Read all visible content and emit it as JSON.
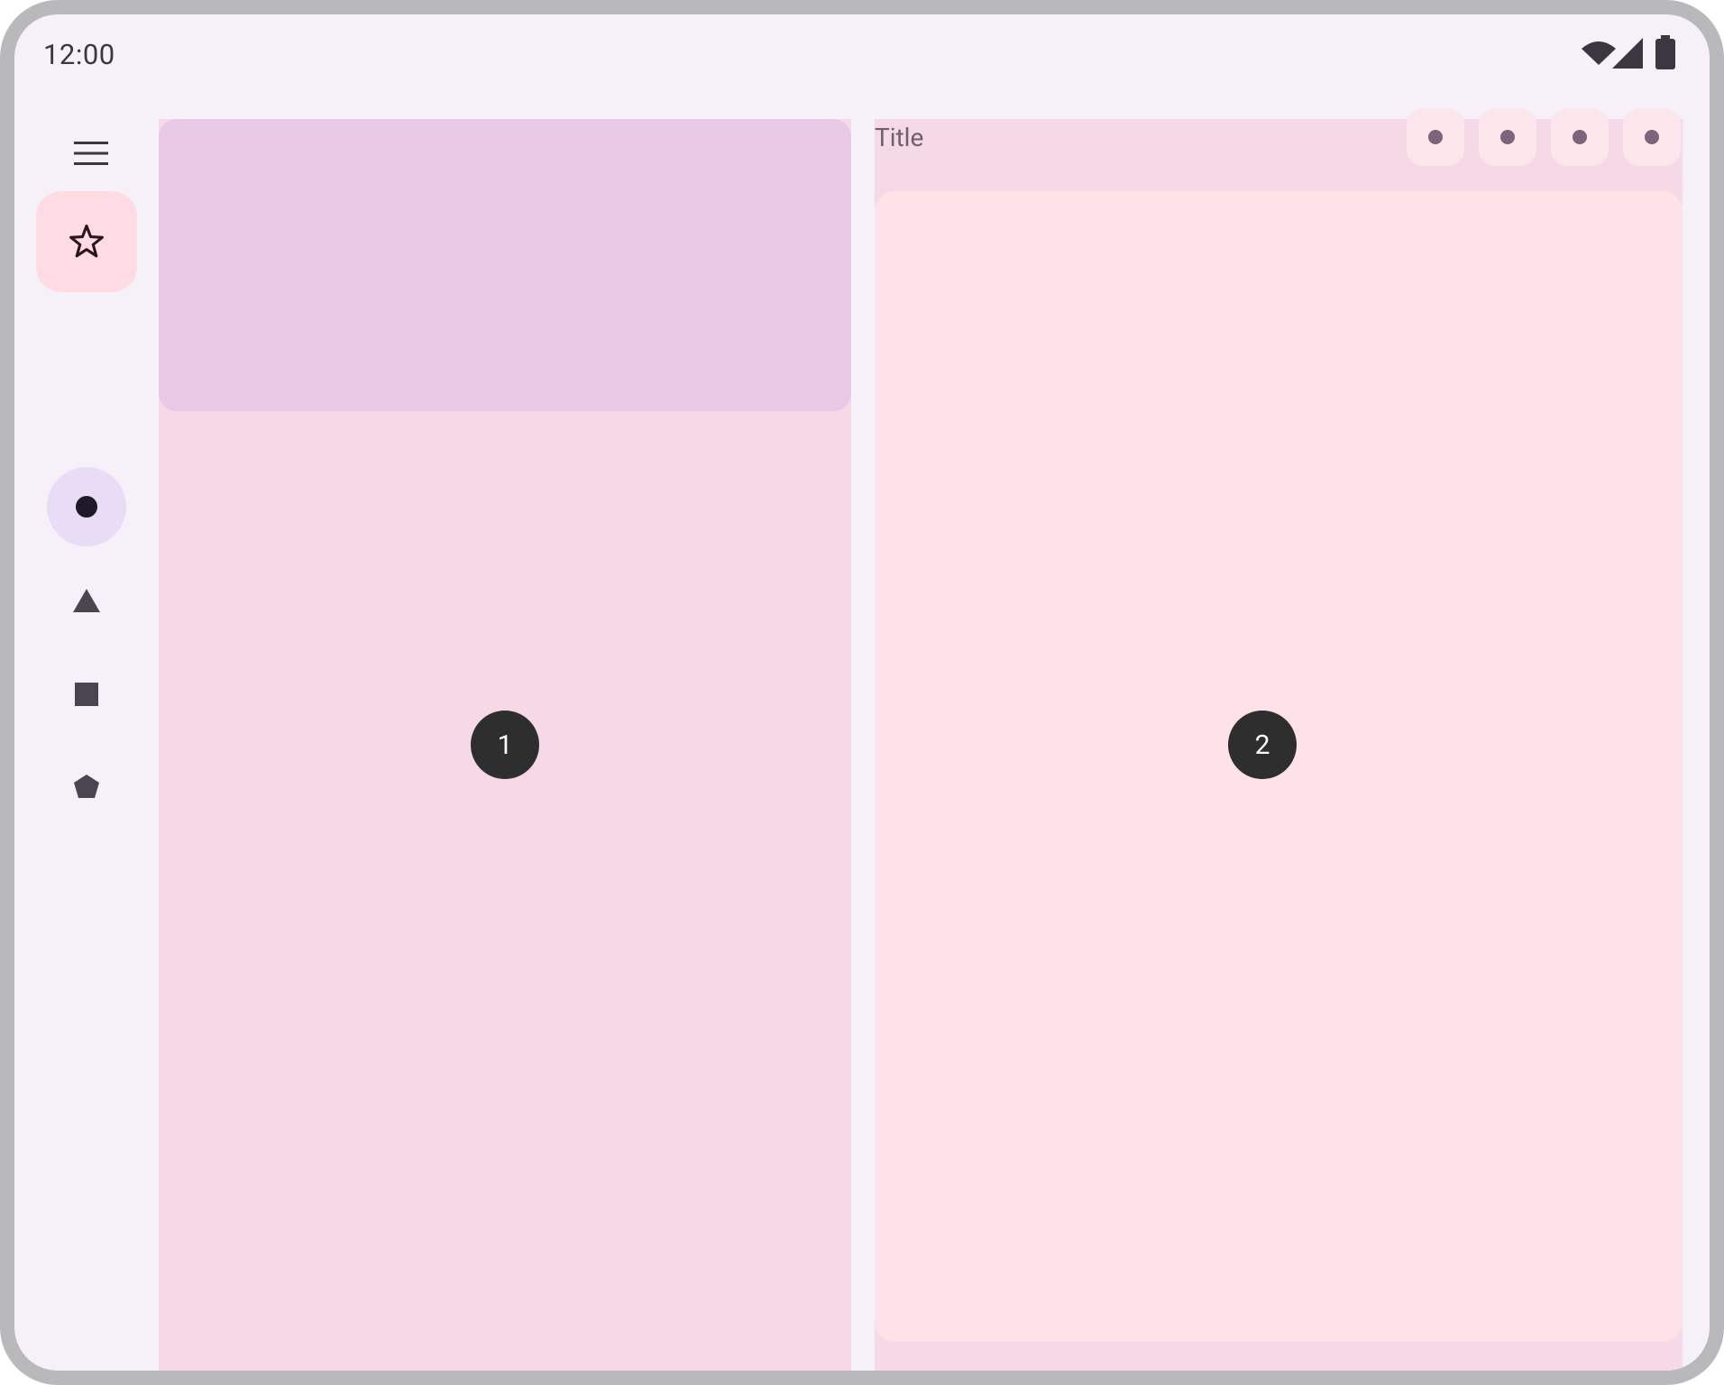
{
  "status_bar": {
    "time": "12:00",
    "icons": [
      "wifi-icon",
      "cellular-signal-icon",
      "battery-icon"
    ]
  },
  "rail": {
    "menu_icon": "hamburger-menu-icon",
    "fab_icon": "star-outline-icon",
    "items": [
      {
        "icon": "circle-icon",
        "selected": true
      },
      {
        "icon": "triangle-icon",
        "selected": false
      },
      {
        "icon": "square-icon",
        "selected": false
      },
      {
        "icon": "pentagon-icon",
        "selected": false
      }
    ]
  },
  "pane1": {
    "badge": "1"
  },
  "pane2": {
    "title": "Title",
    "actions": [
      "action-1",
      "action-2",
      "action-3",
      "action-4"
    ],
    "badge": "2"
  },
  "colors": {
    "device_frame": "#b9b9bb",
    "background": "#f6f1f8",
    "fab": "#ffdbe3",
    "rail_active": "#e9ddf6",
    "pane": "#f6d9e6",
    "pane1_header": "#e8c8e5",
    "pane2_card": "#ffe1e8",
    "badge": "#2e2e2e"
  }
}
